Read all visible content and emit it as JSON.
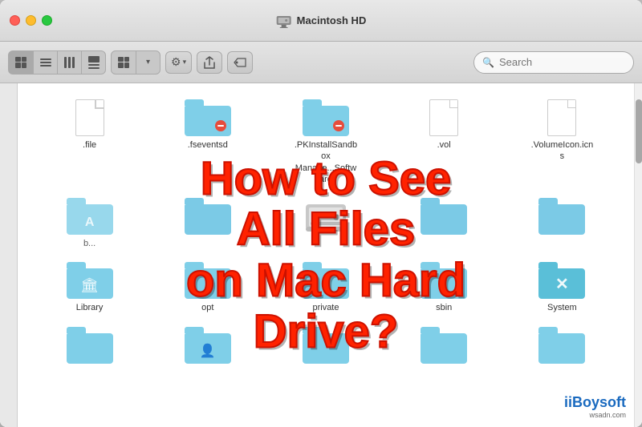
{
  "window": {
    "title": "Macintosh HD",
    "search_placeholder": "Search"
  },
  "toolbar": {
    "view_modes": [
      "icon-view",
      "list-view",
      "column-view",
      "cover-flow"
    ],
    "active_view": "icon-view",
    "gear_label": "⚙",
    "share_label": "↑",
    "tags_label": "⬭"
  },
  "overlay": {
    "line1": "How to See All Files",
    "line2": "on Mac Hard Drive?"
  },
  "branding": {
    "name": "iBoysoft",
    "domain": "wsadn.com"
  },
  "files": {
    "row1": [
      {
        "name": ".file",
        "type": "doc"
      },
      {
        "name": ".fseventsd",
        "type": "folder-badge",
        "color": "lb"
      },
      {
        "name": ".PKInstallSandbox\nManage...Software",
        "type": "folder-badge",
        "color": "lb"
      },
      {
        "name": ".vol",
        "type": "doc"
      },
      {
        "name": ".VolumeIcon.icns",
        "type": "doc"
      }
    ],
    "row2": [
      {
        "name": "b...",
        "type": "folder",
        "color": "lb"
      },
      {
        "name": "",
        "type": "folder-a",
        "color": "mb"
      },
      {
        "name": "",
        "type": "hd-middle",
        "color": "gray"
      },
      {
        "name": "",
        "type": "folder",
        "color": "mb"
      },
      {
        "name": "",
        "type": "folder",
        "color": "mb"
      }
    ],
    "row3": [
      {
        "name": "Library",
        "type": "library",
        "color": "lb"
      },
      {
        "name": "opt",
        "type": "folder",
        "color": "lb"
      },
      {
        "name": "private",
        "type": "folder",
        "color": "lb"
      },
      {
        "name": "sbin",
        "type": "folder",
        "color": "lb"
      },
      {
        "name": "System",
        "type": "system",
        "color": "sb"
      }
    ],
    "row4": [
      {
        "name": "",
        "type": "folder",
        "color": "lb"
      },
      {
        "name": "",
        "type": "folder-user",
        "color": "lb"
      },
      {
        "name": "",
        "type": "folder",
        "color": "lb"
      },
      {
        "name": "",
        "type": "folder",
        "color": "lb"
      },
      {
        "name": "",
        "type": "folder",
        "color": "lb"
      }
    ]
  }
}
